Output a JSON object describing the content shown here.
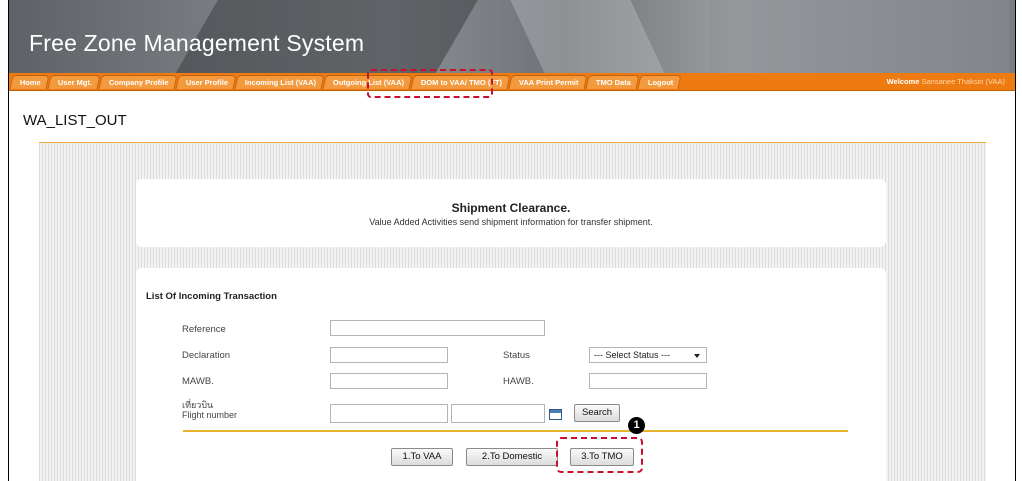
{
  "app": {
    "title": "Free Zone Management System"
  },
  "nav": {
    "items": [
      "Home",
      "User Mgt.",
      "Company Profile",
      "User Profile",
      "Incoming List (VAA)",
      "Outgoing List (VAA)",
      "DOM to VAA/ TMO (FT)",
      "VAA Print Permit",
      "TMO Data",
      "Logout"
    ],
    "welcome_prefix": "Welcome",
    "welcome_user": "Sansanee Thaksin (VAA)"
  },
  "page": {
    "heading": "WA_LIST_OUT"
  },
  "panel1": {
    "title": "Shipment Clearance.",
    "subtitle": "Value Added Activities send shipment information for transfer shipment."
  },
  "form": {
    "section_title": "List Of Incoming Transaction",
    "reference_label": "Reference",
    "declaration_label": "Declaration",
    "status_label": "Status",
    "status_value": "--- Select Status ---",
    "mawb_label": "MAWB.",
    "hawb_label": "HAWB.",
    "flight_label_th": "เที่ยวบิน",
    "flight_label": "Flight number",
    "search_button": "Search"
  },
  "actions": {
    "to_vaa": "1.To VAA",
    "to_domestic": "2.To Domestic",
    "to_tmo": "3.To TMO"
  },
  "annotation": {
    "badge": "1"
  },
  "colors": {
    "nav_orange": "#ee7b12",
    "accent_rule": "#e8a63c",
    "callout_red": "#c8102e"
  }
}
